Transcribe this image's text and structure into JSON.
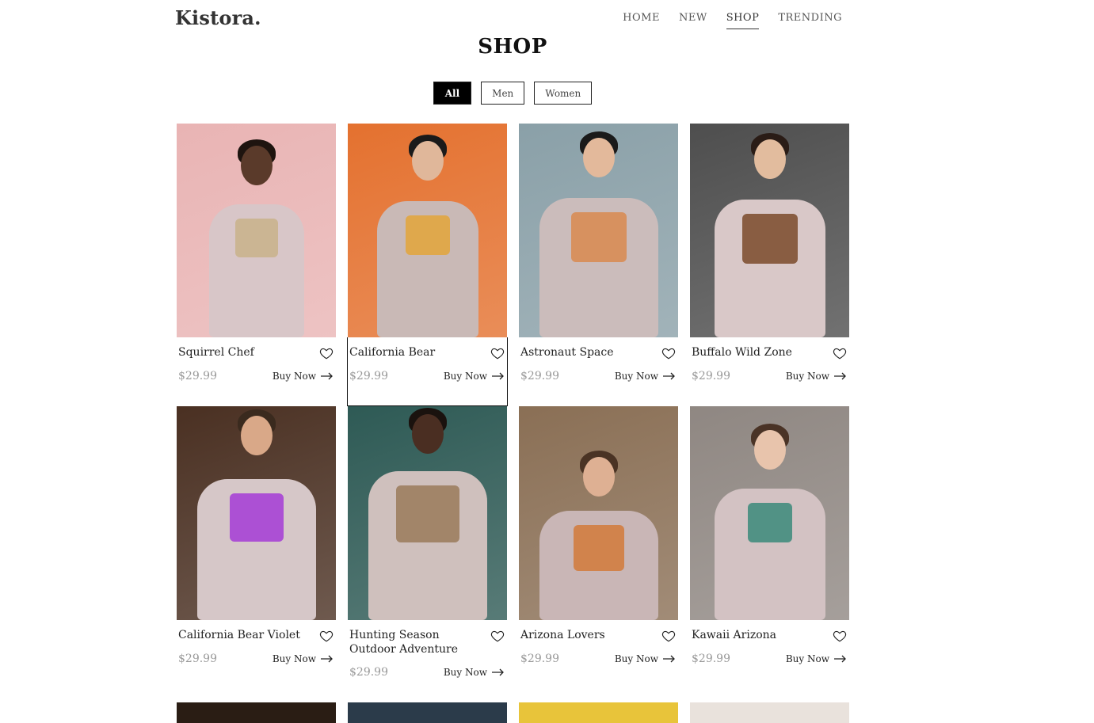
{
  "header": {
    "logo": "Kistora.",
    "nav": [
      {
        "label": "HOME",
        "active": false
      },
      {
        "label": "NEW",
        "active": false
      },
      {
        "label": "SHOP",
        "active": true
      },
      {
        "label": "TRENDING",
        "active": false
      }
    ]
  },
  "page": {
    "title": "SHOP"
  },
  "filters": [
    {
      "label": "All",
      "active": true
    },
    {
      "label": "Men",
      "active": false
    },
    {
      "label": "Women",
      "active": false
    }
  ],
  "products": [
    {
      "name": "Squirrel Chef",
      "price": "$29.99",
      "cta": "Buy Now",
      "bg": "#e9b4b4",
      "shirt": "#d8c6c8",
      "skin": "#5a3a2a",
      "hair": "#1e140f",
      "print": "#c9b28a"
    },
    {
      "name": "California Bear",
      "price": "$29.99",
      "cta": "Buy Now",
      "bg": "#e4712f",
      "shirt": "#c9b9b6",
      "skin": "#e0b79a",
      "hair": "#1a1a1a",
      "print": "#e3a43a"
    },
    {
      "name": "Astronaut Space",
      "price": "$29.99",
      "cta": "Buy Now",
      "bg": "#8aa0a8",
      "shirt": "#cbbcbb",
      "skin": "#e3b99b",
      "hair": "#1a1a1a",
      "print": "#d98a4f"
    },
    {
      "name": "Buffalo Wild Zone",
      "price": "$29.99",
      "cta": "Buy Now",
      "bg": "#4e4e4e",
      "shirt": "#d9c8c8",
      "skin": "#e2bc9e",
      "hair": "#2a1c16",
      "print": "#7a4a2a"
    },
    {
      "name": "California Bear Violet",
      "price": "$29.99",
      "cta": "Buy Now",
      "bg": "#4a3022",
      "shirt": "#d6c7c8",
      "skin": "#d9a888",
      "hair": "#3a2a1e",
      "print": "#a43bd6"
    },
    {
      "name": "Hunting Season Outdoor Adventure",
      "price": "$29.99",
      "cta": "Buy Now",
      "bg": "#2e5a55",
      "shirt": "#cfc0bd",
      "skin": "#4a2e22",
      "hair": "#1a120e",
      "print": "#9a7a5a"
    },
    {
      "name": "Arizona Lovers",
      "price": "$29.99",
      "cta": "Buy Now",
      "bg": "#8a6f55",
      "shirt": "#c9b6b6",
      "skin": "#deb093",
      "hair": "#4a3324",
      "print": "#d27a3a"
    },
    {
      "name": "Kawaii Arizona",
      "price": "$29.99",
      "cta": "Buy Now",
      "bg": "#8f8782",
      "shirt": "#d3c2c3",
      "skin": "#e8c4ac",
      "hair": "#4a3326",
      "print": "#3a8a7a"
    }
  ],
  "more_products_peek": [
    {
      "bg": "#2a1d14"
    },
    {
      "bg": "#2b3b4a"
    },
    {
      "bg": "#e8c43a"
    },
    {
      "bg": "#e9e2dc"
    }
  ]
}
